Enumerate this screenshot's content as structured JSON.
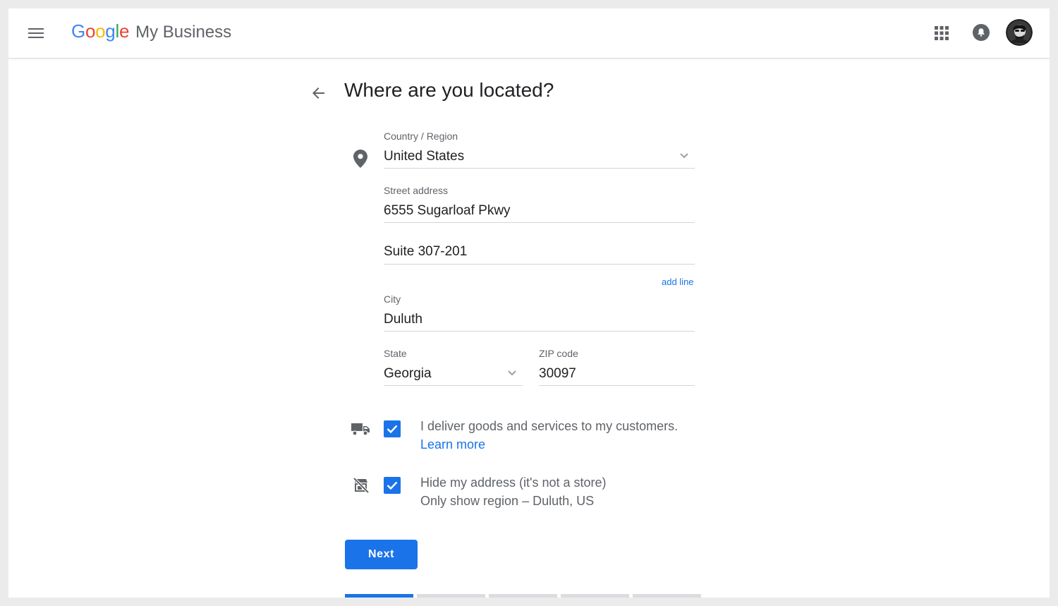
{
  "header": {
    "logo_letters": [
      {
        "ch": "G",
        "color": "#4285F4"
      },
      {
        "ch": "o",
        "color": "#EA4335"
      },
      {
        "ch": "o",
        "color": "#FBBC05"
      },
      {
        "ch": "g",
        "color": "#4285F4"
      },
      {
        "ch": "l",
        "color": "#34A853"
      },
      {
        "ch": "e",
        "color": "#EA4335"
      }
    ],
    "product_name": "My Business",
    "icons": {
      "menu": "hamburger-menu-icon",
      "apps": "apps-grid-icon",
      "notifications": "bell-icon",
      "account": "avatar"
    }
  },
  "page": {
    "title": "Where are you located?",
    "back_icon": "arrow-left-icon"
  },
  "form": {
    "country": {
      "label": "Country / Region",
      "value": "United States"
    },
    "street": {
      "label": "Street address",
      "value": "6555 Sugarloaf Pkwy"
    },
    "street2": {
      "value": "Suite 307-201"
    },
    "add_line": "add line",
    "city": {
      "label": "City",
      "value": "Duluth"
    },
    "state": {
      "label": "State",
      "value": "Georgia"
    },
    "zip": {
      "label": "ZIP code",
      "value": "30097"
    },
    "deliver": {
      "checked": true,
      "text": "I deliver goods and services to my customers.",
      "link": "Learn more"
    },
    "hide_address": {
      "checked": true,
      "text": "Hide my address (it's not a store)",
      "subtext": "Only show region – Duluth, US"
    },
    "next_label": "Next"
  },
  "progress": {
    "total_steps": 5,
    "current_step": 1
  },
  "colors": {
    "accent": "#1a73e8",
    "muted_text": "#5f6368",
    "divider": "#dadce0"
  }
}
